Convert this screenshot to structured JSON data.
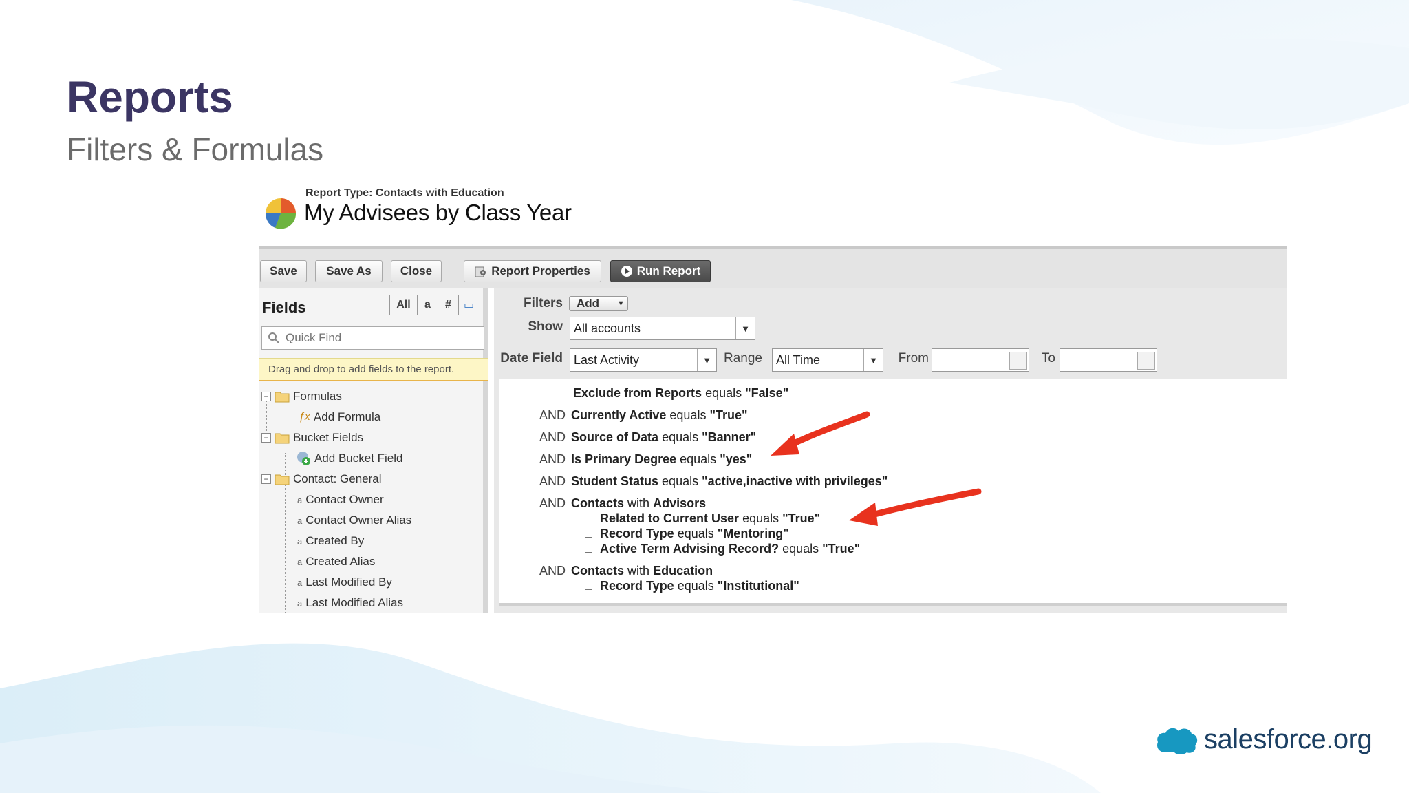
{
  "slide": {
    "title": "Reports",
    "subtitle": "Filters & Formulas",
    "logo": "salesforce.org",
    "colors": {
      "title": "#3b3563",
      "arrow": "#e8321e",
      "logo": "#1798c1"
    }
  },
  "report": {
    "type_label": "Report Type: Contacts with Education",
    "title": "My Advisees by Class Year"
  },
  "toolbar": {
    "save": "Save",
    "save_as": "Save As",
    "close": "Close",
    "properties": "Report Properties",
    "run": "Run Report"
  },
  "fields_panel": {
    "title": "Fields",
    "tabs": [
      "All",
      "a",
      "#",
      "▭"
    ],
    "search_placeholder": "Quick Find",
    "hint": "Drag and drop to add fields to the report.",
    "tree": [
      {
        "label": "Formulas",
        "kind": "folder"
      },
      {
        "label": "Add Formula",
        "kind": "formula"
      },
      {
        "label": "Bucket Fields",
        "kind": "folder"
      },
      {
        "label": "Add Bucket Field",
        "kind": "bucket"
      },
      {
        "label": "Contact: General",
        "kind": "folder"
      },
      {
        "label": "Contact Owner",
        "kind": "field"
      },
      {
        "label": "Contact Owner Alias",
        "kind": "field"
      },
      {
        "label": "Created By",
        "kind": "field"
      },
      {
        "label": "Created Alias",
        "kind": "field"
      },
      {
        "label": "Last Modified By",
        "kind": "field"
      },
      {
        "label": "Last Modified Alias",
        "kind": "field"
      }
    ]
  },
  "filters": {
    "label": "Filters",
    "add": "Add",
    "show_label": "Show",
    "show_value": "All accounts",
    "date_field_label": "Date Field",
    "date_field_value": "Last Activity",
    "range_label": "Range",
    "range_value": "All Time",
    "from_label": "From",
    "to_label": "To",
    "criteria": [
      {
        "prefix": "",
        "field": "Exclude from Reports",
        "op": "equals",
        "value": "\"False\""
      },
      {
        "prefix": "AND",
        "field": "Currently Active",
        "op": "equals",
        "value": "\"True\""
      },
      {
        "prefix": "AND",
        "field": "Source of Data",
        "op": "equals",
        "value": "\"Banner\""
      },
      {
        "prefix": "AND",
        "field": "Is Primary Degree",
        "op": "equals",
        "value": "\"yes\""
      },
      {
        "prefix": "AND",
        "field": "Student Status",
        "op": "equals",
        "value": "\"active,inactive with privileges\""
      },
      {
        "prefix": "AND",
        "field": "Contacts",
        "op": "with",
        "value": "Advisors"
      },
      {
        "prefix": "AND",
        "field": "Contacts",
        "op": "with",
        "value": "Education"
      }
    ],
    "sub_advisors": [
      {
        "field": "Related to Current User",
        "op": "equals",
        "value": "\"True\""
      },
      {
        "field": "Record Type",
        "op": "equals",
        "value": "\"Mentoring\""
      },
      {
        "field": "Active Term Advising Record?",
        "op": "equals",
        "value": "\"True\""
      }
    ],
    "sub_education": [
      {
        "field": "Record Type",
        "op": "equals",
        "value": "\"Institutional\""
      }
    ]
  }
}
